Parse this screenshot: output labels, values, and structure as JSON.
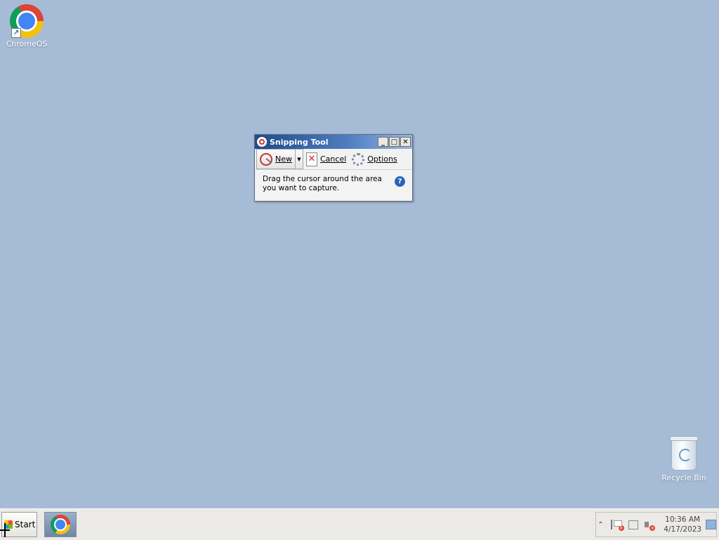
{
  "desktop": {
    "icons": [
      {
        "label": "ChromeOS",
        "icon": "chrome-icon"
      },
      {
        "label": "Recycle Bin",
        "icon": "recycle-bin-icon"
      }
    ],
    "background_color": "#a6bcd6"
  },
  "snipping_tool": {
    "title": "Snipping Tool",
    "toolbar": {
      "new_label": "New",
      "cancel_label": "Cancel",
      "options_label": "Options"
    },
    "message_line1": "Drag the cursor around the area",
    "message_line2": "you want to capture.",
    "help_glyph": "?"
  },
  "taskbar": {
    "start_label": "Start",
    "clock_time": "10:36 AM",
    "clock_date": "4/17/2023"
  }
}
